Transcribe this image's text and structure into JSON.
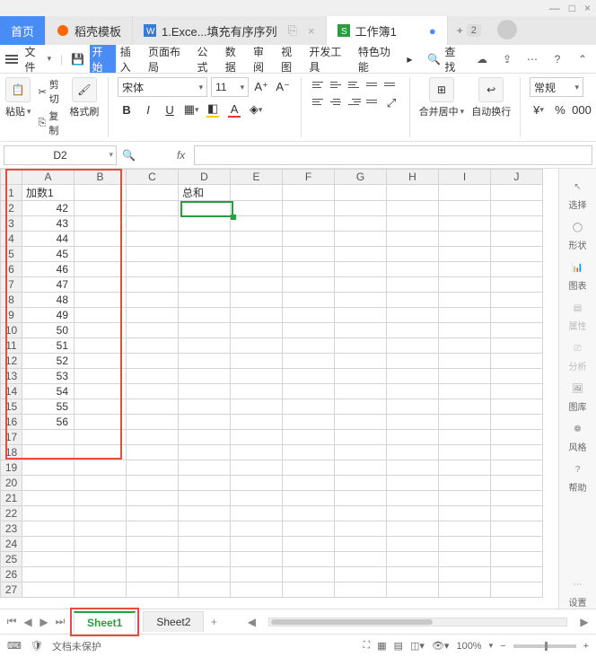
{
  "window": {
    "min": "—",
    "max": "□",
    "close": "×"
  },
  "doctabs": {
    "home": "首页",
    "shell": "稻壳模板",
    "excel": "1.Exce...填充有序序列",
    "workbook": "工作簿1",
    "badge": "2",
    "add": "+"
  },
  "ribbon": {
    "file": "文件",
    "tabs": [
      "开始",
      "插入",
      "页面布局",
      "公式",
      "数据",
      "审阅",
      "视图",
      "开发工具",
      "特色功能"
    ],
    "ellipsis": "...",
    "search": "查找"
  },
  "toolbar": {
    "paste": "粘贴",
    "copy": "复制",
    "cut": "剪切",
    "brush": "格式刷",
    "font": "宋体",
    "size": "11",
    "merge": "合并居中",
    "wrap": "自动换行",
    "normal": "常规"
  },
  "namebox": "D2",
  "fx": "fx",
  "columns": [
    "A",
    "B",
    "C",
    "D",
    "E",
    "F",
    "G",
    "H",
    "I",
    "J"
  ],
  "rows": [
    "1",
    "2",
    "3",
    "4",
    "5",
    "6",
    "7",
    "8",
    "9",
    "10",
    "11",
    "12",
    "13",
    "14",
    "15",
    "16",
    "17",
    "18",
    "19",
    "20",
    "21",
    "22",
    "23",
    "24",
    "25",
    "26",
    "27"
  ],
  "cells": {
    "A1": "加数1",
    "D1": "总和",
    "A2": "42",
    "A3": "43",
    "A4": "44",
    "A5": "45",
    "A6": "46",
    "A7": "47",
    "A8": "48",
    "A9": "49",
    "A10": "50",
    "A11": "51",
    "A12": "52",
    "A13": "53",
    "A14": "54",
    "A15": "55",
    "A16": "56"
  },
  "side": {
    "select": "选择",
    "shape": "形状",
    "chart": "图表",
    "prop": "属性",
    "analyze": "分析",
    "gallery": "图库",
    "style": "风格",
    "help": "帮助",
    "settings": "设置"
  },
  "sheets": {
    "s1": "Sheet1",
    "s2": "Sheet2",
    "add": "+"
  },
  "status": {
    "protect": "文档未保护",
    "zoom": "100%",
    "minus": "−",
    "plus": "+"
  }
}
